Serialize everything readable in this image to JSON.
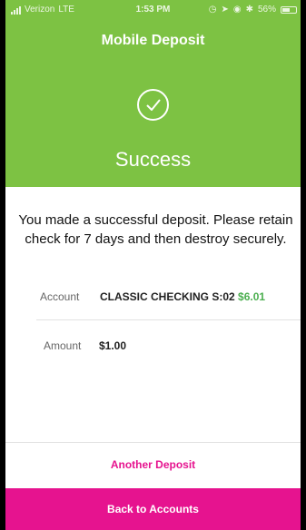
{
  "status_bar": {
    "carrier": "Verizon",
    "network": "LTE",
    "time": "1:53 PM",
    "battery_percent": "56%",
    "icons": [
      "signal-icon",
      "alarm-icon",
      "location-icon",
      "lock-rotation-icon",
      "bluetooth-icon",
      "battery-icon"
    ]
  },
  "header": {
    "title": "Mobile Deposit",
    "status_icon": "check-icon",
    "status_text": "Success",
    "background_color": "#7dc243"
  },
  "body": {
    "message": "You made a successful deposit.  Please retain check for 7 days and then destroy securely.",
    "account_label": "Account",
    "account_name": "CLASSIC CHECKING S:02",
    "account_balance": "$6.01",
    "amount_label": "Amount",
    "amount_value": "$1.00"
  },
  "actions": {
    "another_deposit_label": "Another Deposit",
    "back_to_accounts_label": "Back to Accounts",
    "accent_color": "#e6138f"
  }
}
